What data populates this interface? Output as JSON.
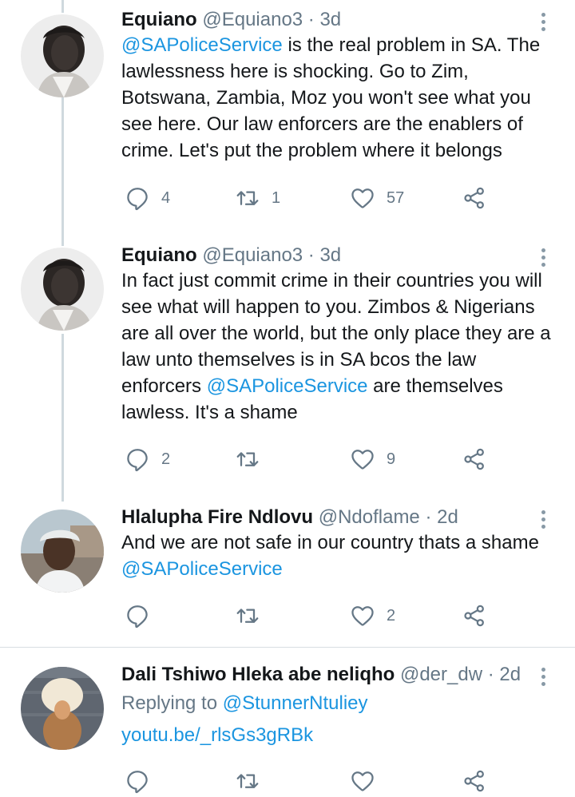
{
  "tweets": [
    {
      "name": "Equiano",
      "meta": "@Equiano3 · 3d",
      "handle": "@SAPoliceService",
      "text": " is the real problem in SA. The lawlessness here is shocking. Go to Zim, Botswana, Zambia, Moz you won't see what you see here. Our law enforcers are the enablers of crime. Let's put the problem where it belongs",
      "reply_count": "4",
      "retweet_count": "1",
      "like_count": "57"
    },
    {
      "name": "Equiano",
      "meta": "@Equiano3 · 3d",
      "text_a": "In fact just commit crime in their countries you will see what will happen to you. Zimbos & Nigerians are all over the world, but the only place they are a law unto themselves is in SA bcos the law enforcers ",
      "handle": "@SAPoliceService",
      "text_b": " are themselves lawless. It's a shame",
      "reply_count": "2",
      "retweet_count": "",
      "like_count": "9"
    },
    {
      "name": "Hlalupha Fire Ndlovu",
      "meta": "@Ndoflame · 2d",
      "text": "And we are not safe in our country thats a shame",
      "handle": "@SAPoliceService",
      "reply_count": "",
      "retweet_count": "",
      "like_count": "2"
    },
    {
      "name": "Dali Tshiwo Hleka abe neliqho",
      "meta": "@der_dw · 2d",
      "replying_prefix": "Replying to ",
      "replying_handle": "@StunnerNtuliey",
      "link": "youtu.be/_rlsGs3gRBk"
    }
  ],
  "colors": {
    "link": "#1b95e0",
    "meta": "#657786",
    "thread_line": "#cfd9de"
  },
  "icons": [
    "reply-icon",
    "retweet-icon",
    "like-icon",
    "share-icon",
    "more-icon"
  ]
}
